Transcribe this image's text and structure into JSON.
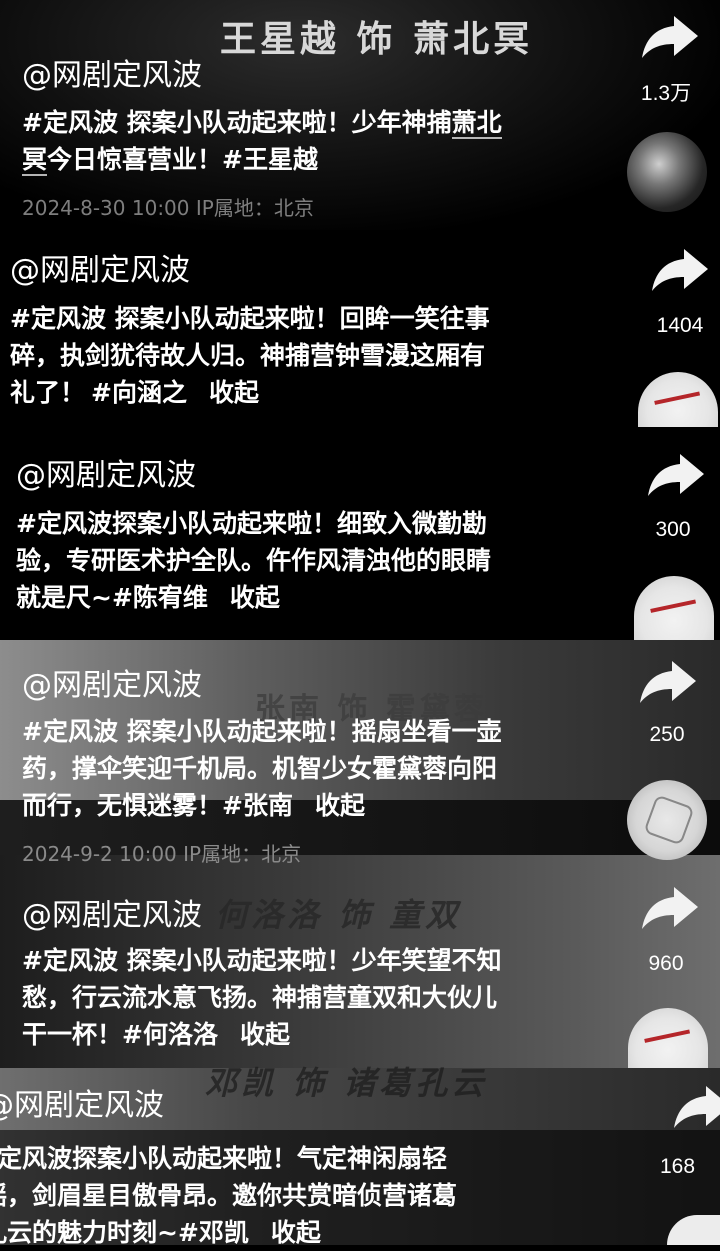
{
  "posts": [
    {
      "overlay": "王星越 饰 萧北冥",
      "author": "@网剧定风波",
      "caption_tag": "#定风波",
      "caption_line1_rest": " 探案小队动起来啦！少年神捕",
      "caption_line1_hl": "萧北",
      "caption_line2_hl": "冥",
      "caption_line2_rest": "今日惊喜营业！",
      "caption_line2_tag": "#王星越",
      "meta": "2024-8-30 10:00   IP属地：北京",
      "share_count": "1.3万"
    },
    {
      "author": "@网剧定风波",
      "caption_tag": "#定风波",
      "caption_line1_rest": " 探案小队动起来啦！回眸一笑往事",
      "caption_line2": "碎，执剑犹待故人归。神捕营钟雪漫这厢有",
      "caption_line3": "礼了！",
      "caption_line3_tag": "#向涵之",
      "fold": "收起",
      "share_count": "1404"
    },
    {
      "author": "@网剧定风波",
      "caption_tag": "#定风波",
      "caption_line1_rest": "探案小队动起来啦！细致入微勤勘",
      "caption_line2": "验，专研医术护全队。仵作风清浊他的眼睛",
      "caption_line3": "就是尺~",
      "caption_line3_tag": "#陈宥维",
      "fold": "收起",
      "share_count": "300"
    },
    {
      "overlay": "张南 饰 霍黛蓉",
      "author": "@网剧定风波",
      "caption_tag": "#定风波",
      "caption_line1_rest": " 探案小队动起来啦！摇扇坐看一壶",
      "caption_line2": "药，撑伞笑迎千机局。机智少女霍黛蓉向阳",
      "caption_line3": "而行，无惧迷雾！",
      "caption_line3_tag": "#张南",
      "fold": "收起",
      "meta": "2024-9-2 10:00   IP属地：北京",
      "share_count": "250"
    },
    {
      "overlay": "何洛洛 饰 童双",
      "author": "@网剧定风波",
      "caption_tag": "#定风波",
      "caption_line1_rest": " 探案小队动起来啦！少年笑望不知",
      "caption_line2": "愁，行云流水意飞扬。神捕营童双和大伙儿",
      "caption_line3": "干一杯！",
      "caption_line3_tag": "#何洛洛",
      "fold": "收起",
      "share_count": "960"
    },
    {
      "overlay": "邓凯 饰 诸葛孔云",
      "author": "@网剧定风波",
      "caption_tag": "#定风波",
      "caption_line1_rest": "探案小队动起来啦！气定神闲扇轻",
      "caption_line2": "摇，剑眉星目傲骨昂。邀你共赏暗侦营诸葛",
      "caption_line3": "孔云的魅力时刻~",
      "caption_line3_tag": "#邓凯",
      "fold": "收起",
      "share_count": "168"
    }
  ],
  "icons": {
    "share": "share-arrow-icon",
    "avatar": "account-avatar"
  },
  "colors": {
    "text": "#ffffff",
    "meta": "#7e7e7e",
    "background": "#000000"
  }
}
